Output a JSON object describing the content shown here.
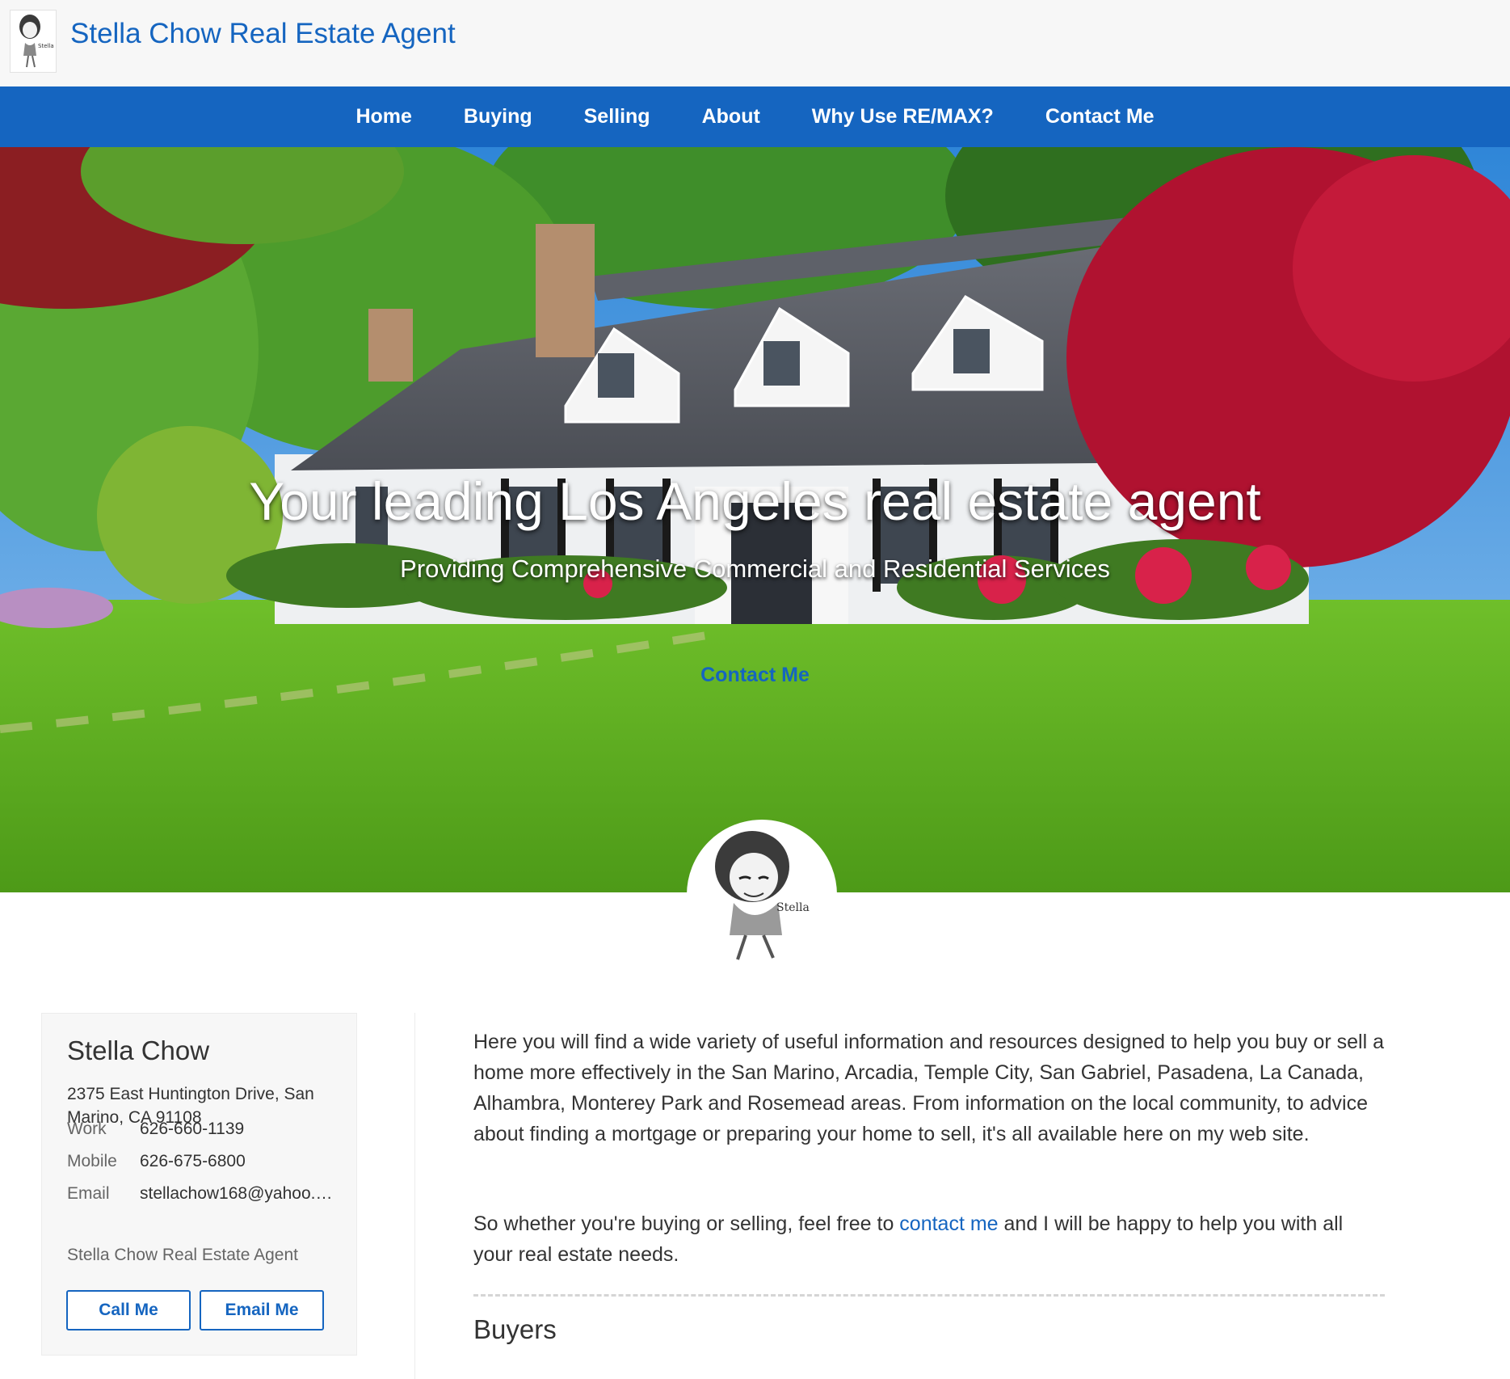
{
  "header": {
    "title": "Stella Chow Real Estate Agent"
  },
  "nav": [
    "Home",
    "Buying",
    "Selling",
    "About",
    "Why Use RE/MAX?",
    "Contact Me"
  ],
  "hero": {
    "title": "Your leading Los Angeles real estate agent",
    "subtitle": "Providing Comprehensive Commercial and Residential Services",
    "cta": "Contact Me"
  },
  "sidebar": {
    "name": "Stella Chow",
    "address": "2375 East Huntington Drive, San Marino, CA 91108",
    "work_label": "Work",
    "work": "626-660-1139",
    "mobile_label": "Mobile",
    "mobile": "626-675-6800",
    "email_label": "Email",
    "email": "stellachow168@yahoo.…",
    "company": "Stella Chow Real Estate Agent",
    "call_btn": "Call Me",
    "email_btn": "Email Me"
  },
  "main": {
    "intro": "Here you will find a wide variety of useful information and resources designed to help you buy or sell a home more effectively in the San Marino, Arcadia, Temple City, San Gabriel, Pasadena, La Canada, Alhambra, Monterey Park and Rosemead areas. From information on the local community, to advice about finding a mortgage or preparing your home to sell, it's all available here on my web site.",
    "para2_before": "So whether you're buying or selling, feel free to ",
    "para2_link": "contact me",
    "para2_after": " and I will be happy to help you with all your real estate needs.",
    "section_heading": "Buyers"
  },
  "colors": {
    "brand_blue": "#1565c0",
    "header_bg": "#f7f7f7"
  }
}
